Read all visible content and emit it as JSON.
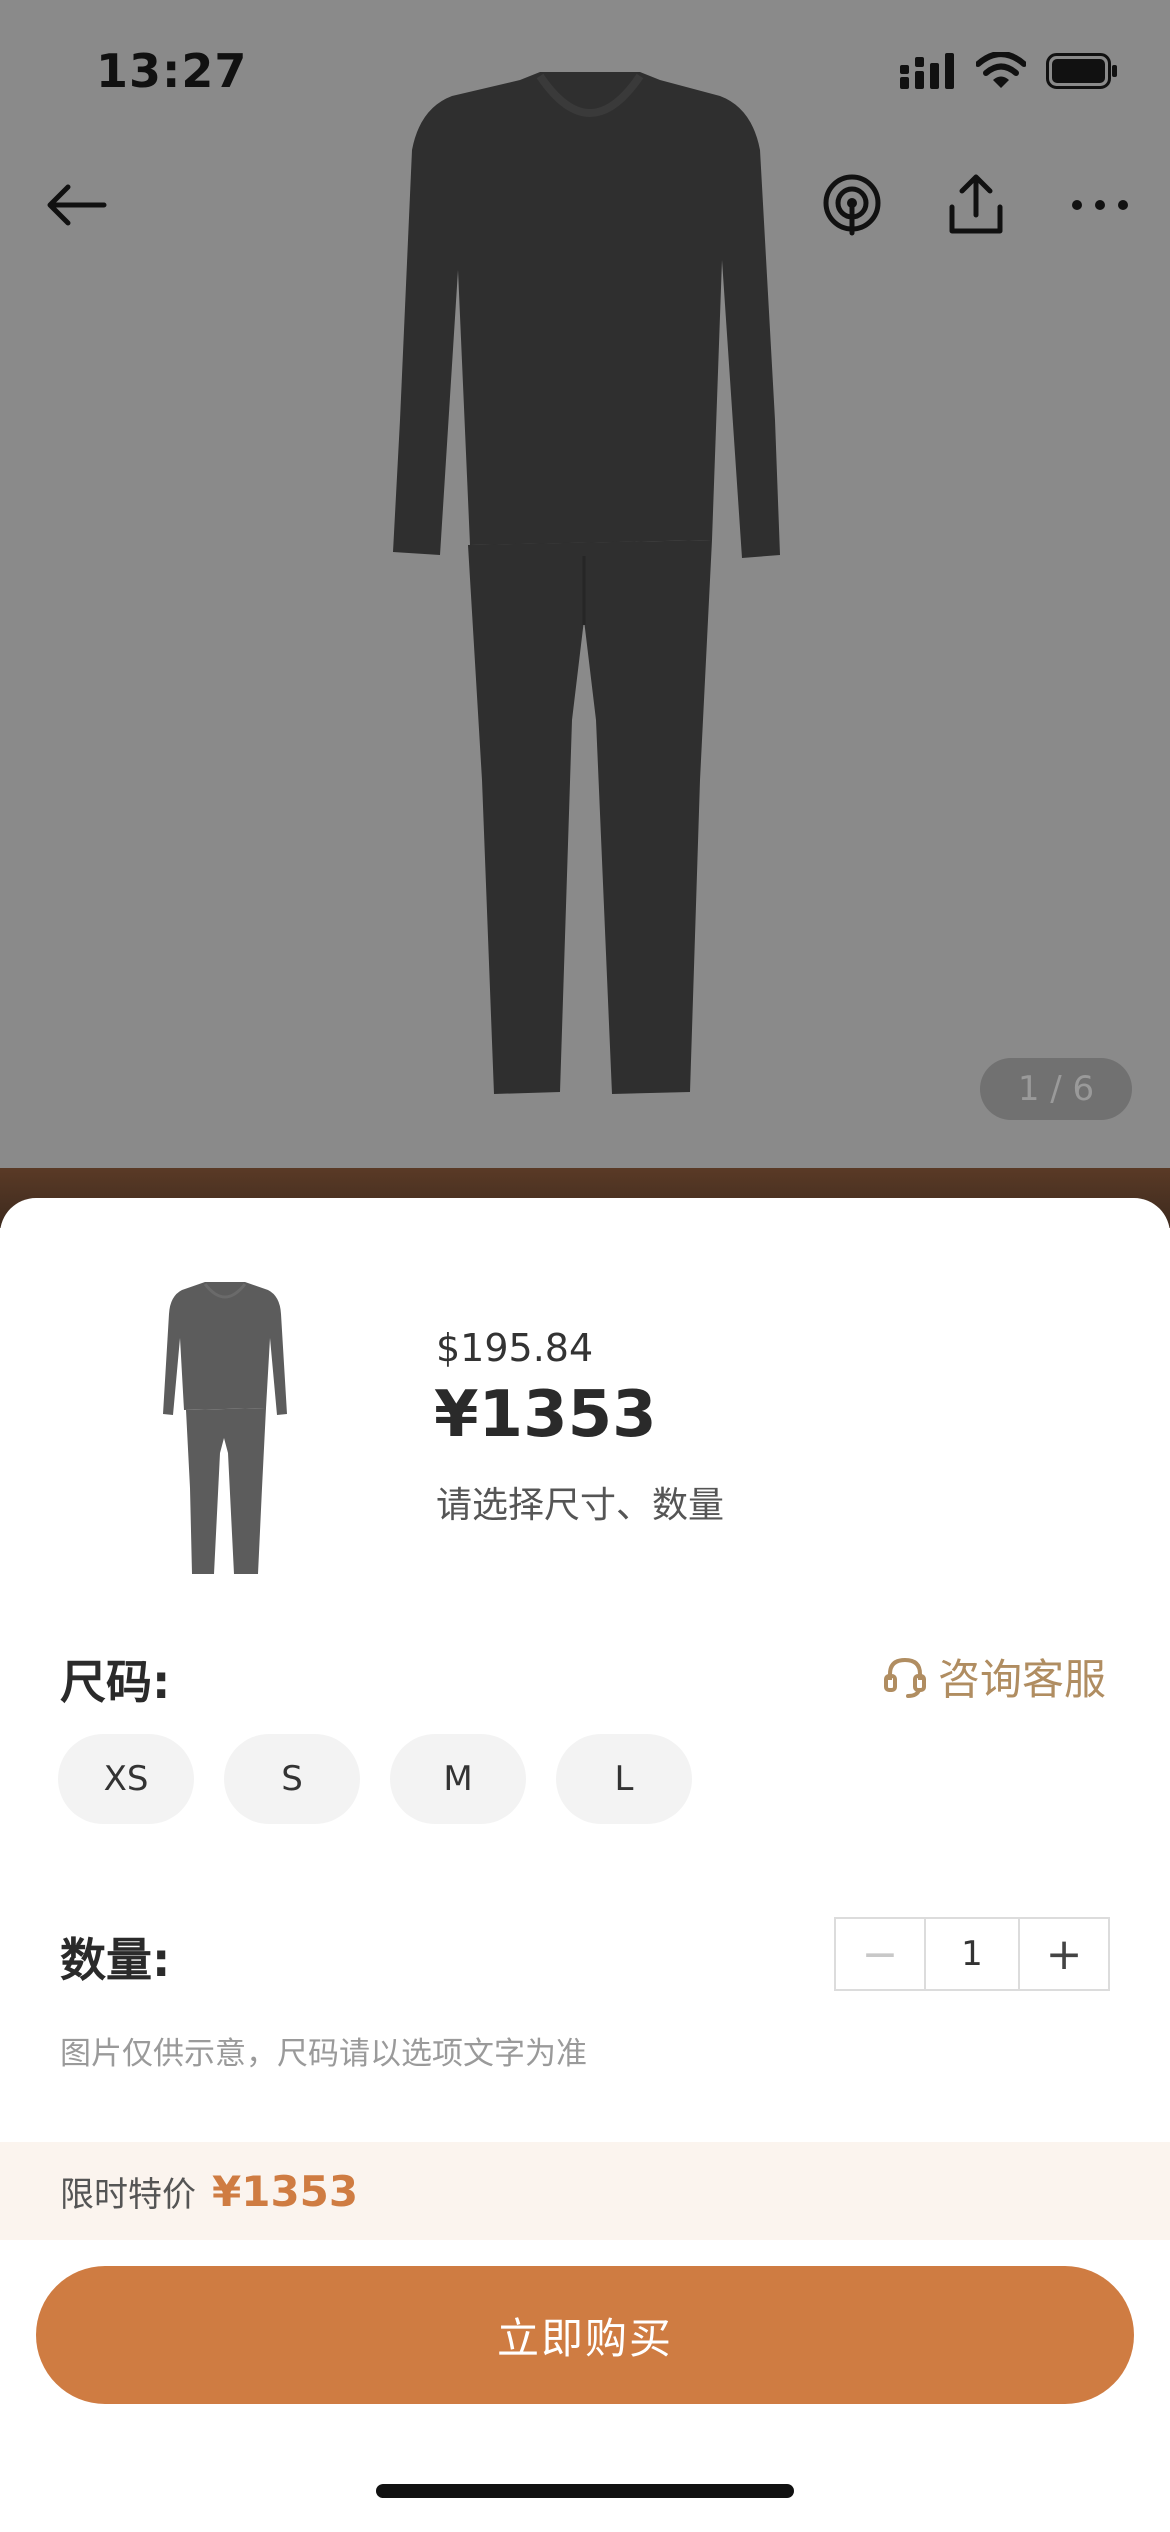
{
  "status_bar": {
    "time": "13:27"
  },
  "gallery": {
    "counter": "1 / 6"
  },
  "product": {
    "price_usd": "$195.84",
    "price_cny": "¥1353",
    "select_hint": "请选择尺寸、数量"
  },
  "size_section": {
    "label": "尺码:",
    "service_label": "咨询客服",
    "options": [
      "XS",
      "S",
      "M",
      "L"
    ]
  },
  "quantity_section": {
    "label": "数量:",
    "value": "1",
    "minus": "−",
    "plus": "+"
  },
  "disclaimer": "图片仅供示意，尺码请以选项文字为准",
  "promo": {
    "label": "限时特价",
    "price": "¥1353"
  },
  "buy_button": "立即购买",
  "colors": {
    "accent": "#cf7c42",
    "service_gold": "#b08d61",
    "promo_bg": "#fbf4ee",
    "garment": "#2f2f2f"
  }
}
